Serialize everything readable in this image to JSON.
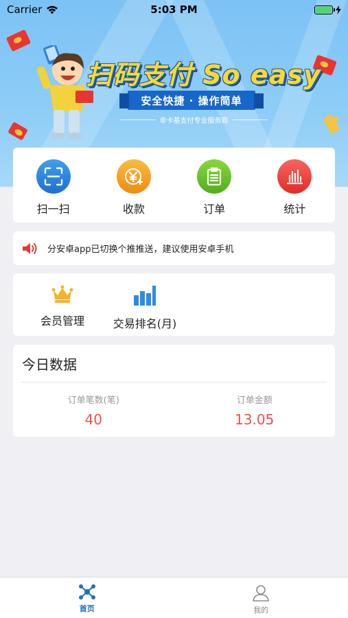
{
  "status_bar": {
    "carrier": "Carrier",
    "time": "5:03 PM"
  },
  "banner": {
    "title": "扫码支付 So easy",
    "ribbon": "安全快捷 · 操作简单",
    "subtitle": "非卡基支付专业服务商"
  },
  "quick_actions": [
    {
      "label": "扫一扫",
      "icon": "scan-icon",
      "color": "#2b8ae0"
    },
    {
      "label": "收款",
      "icon": "yuan-coin-icon",
      "color": "#f6a623"
    },
    {
      "label": "订单",
      "icon": "clipboard-icon",
      "color": "#6ac62b"
    },
    {
      "label": "统计",
      "icon": "bar-stats-icon",
      "color": "#ee4540"
    }
  ],
  "notice": {
    "icon": "speaker-icon",
    "text": "分安卓app已切换个推推送，建议使用安卓手机"
  },
  "tools": [
    {
      "label": "会员管理",
      "icon": "crown-icon",
      "color": "#f5b326"
    },
    {
      "label": "交易排名(月)",
      "icon": "bar-chart-icon",
      "color": "#2f8be0"
    }
  ],
  "today": {
    "title": "今日数据",
    "order_count_label": "订单笔数(笔)",
    "order_count_value": "40",
    "order_amount_label": "订单金额",
    "order_amount_value": "13.05"
  },
  "tab_bar": [
    {
      "label": "首页",
      "icon": "home-network-icon",
      "active": true
    },
    {
      "label": "我的",
      "icon": "person-icon",
      "active": false
    }
  ],
  "colors": {
    "accent": "#1c6fc6",
    "value_red": "#e9514c"
  }
}
